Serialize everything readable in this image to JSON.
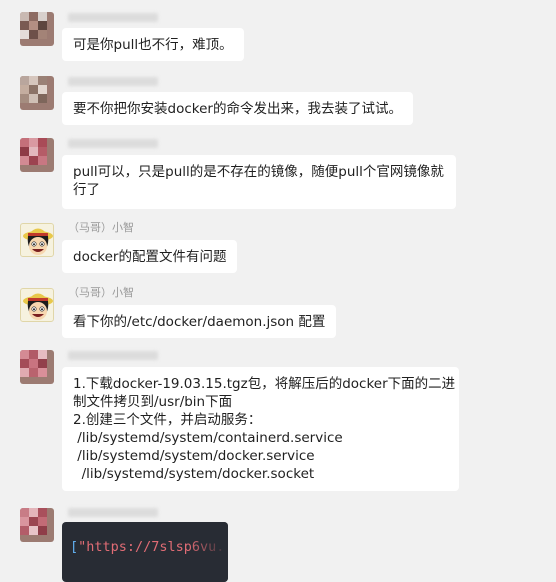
{
  "messages": [
    {
      "sender": "",
      "avatar": "blurred-avatar",
      "lines": [
        "可是你pull也不行，难顶。"
      ]
    },
    {
      "sender": "",
      "avatar": "blurred-avatar",
      "lines": [
        "要不你把你安装docker的命令发出来，我去装了试试。"
      ]
    },
    {
      "sender": "",
      "avatar": "blurred-avatar",
      "lines": [
        "pull可以，只是pull的是不存在的镜像，随便pull个官网镜像就",
        "行了"
      ]
    },
    {
      "sender": "（马哥）小智",
      "avatar": "luffy-avatar",
      "lines": [
        "docker的配置文件有问题"
      ]
    },
    {
      "sender": "（马哥）小智",
      "avatar": "luffy-avatar",
      "lines": [
        "看下你的/etc/docker/daemon.json 配置"
      ]
    },
    {
      "sender": "",
      "avatar": "blurred-avatar",
      "lines": [
        "1.下载docker-19.03.15.tgz包，将解压后的docker下面的二进",
        "制文件拷贝到/usr/bin下面",
        "2.创建三个文件，并启动服务：",
        " /lib/systemd/system/containerd.service",
        " /lib/systemd/system/docker.service",
        "  /lib/systemd/system/docker.socket"
      ]
    },
    {
      "sender": "",
      "avatar": "blurred-avatar",
      "code_bracket": "[",
      "code_text": "\"https://7slsp6vu."
    }
  ],
  "colors": {
    "background": "#f1f1f1",
    "bubble": "#ffffff",
    "code_bg": "#282c34"
  }
}
